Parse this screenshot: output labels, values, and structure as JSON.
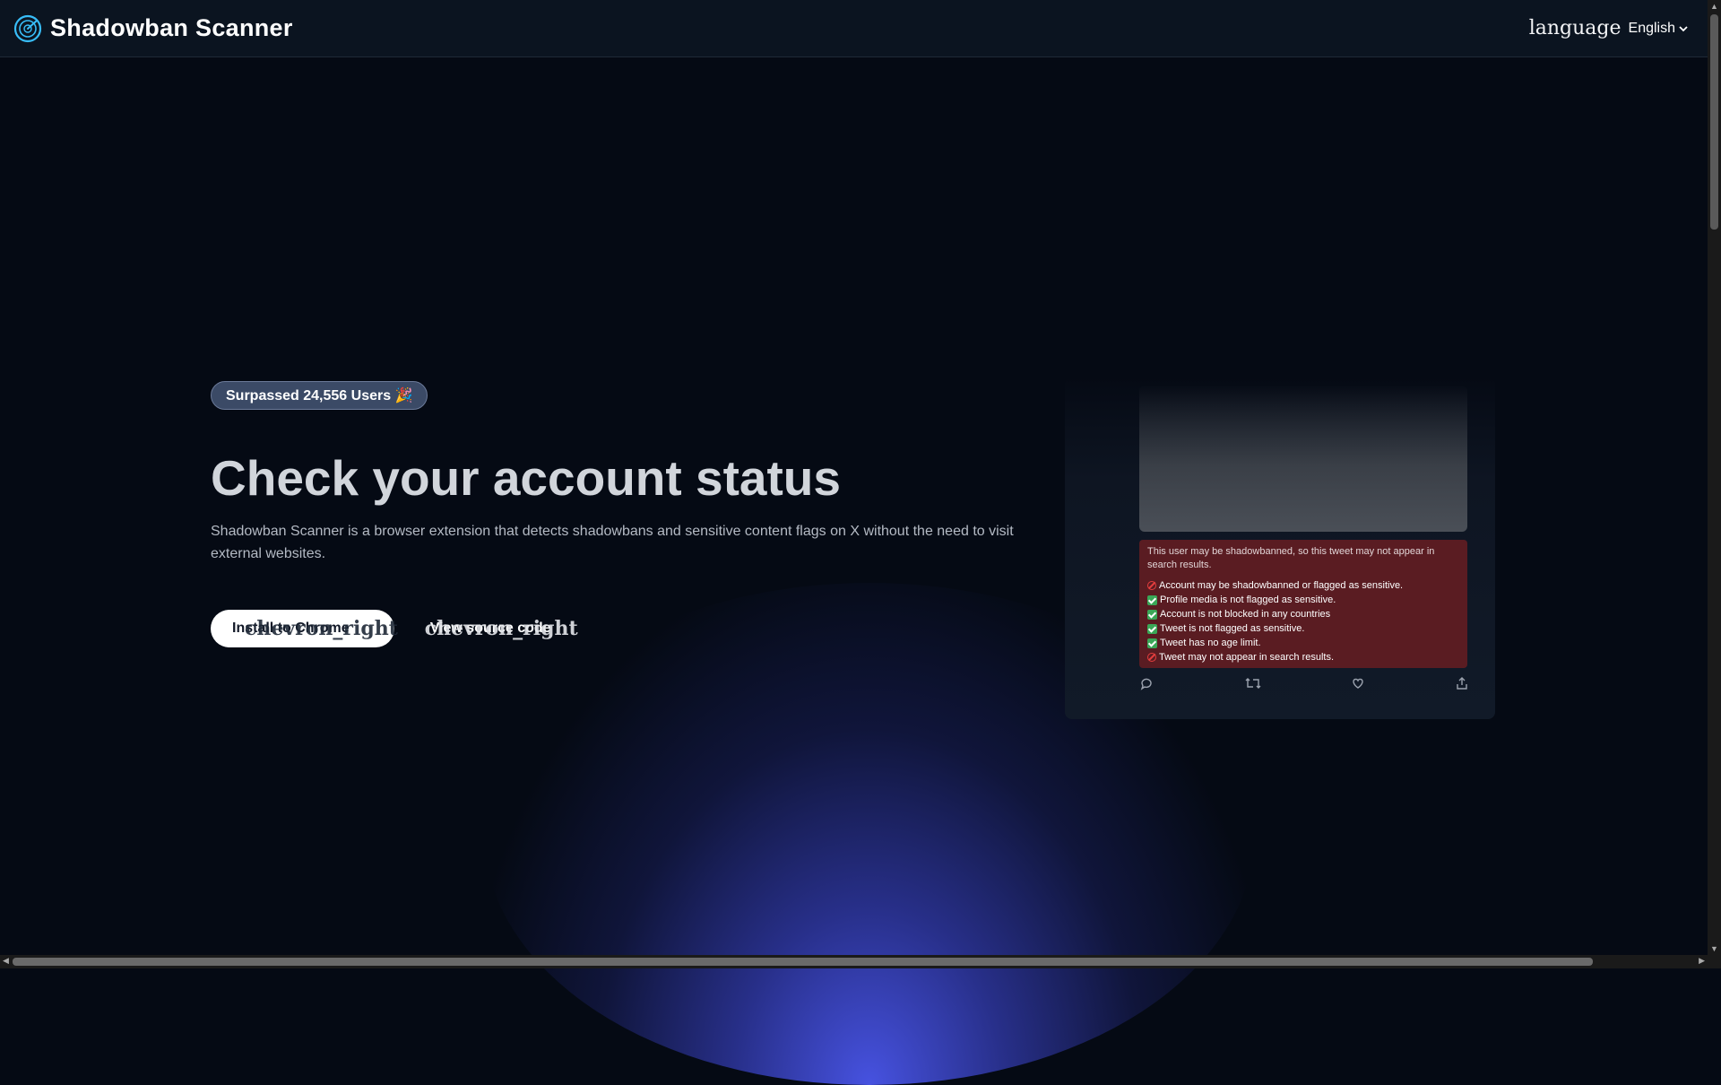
{
  "header": {
    "brand_name": "Shadowban Scanner",
    "language_icon_label": "language",
    "language_selected": "English"
  },
  "hero": {
    "badge": "Surpassed 24,556 Users 🎉",
    "title": "Check your account status",
    "description": "Shadowban Scanner is a browser extension that detects shadowbans and sensitive content flags on X without the need to visit external websites.",
    "primary_button": {
      "label": "Install to Chrome",
      "icon_label": "chevron_right"
    },
    "secondary_button": {
      "label": "View source code",
      "icon_label": "chevron_right"
    }
  },
  "preview": {
    "warning_intro": "This user may be shadowbanned, so this tweet may not appear in search results.",
    "checks": [
      {
        "status": "bad",
        "text": "Account may be shadowbanned or flagged as sensitive."
      },
      {
        "status": "ok",
        "text": "Profile media is not flagged as sensitive."
      },
      {
        "status": "ok",
        "text": "Account is not blocked in any countries"
      },
      {
        "status": "ok",
        "text": "Tweet is not flagged as sensitive."
      },
      {
        "status": "ok",
        "text": "Tweet has no age limit."
      },
      {
        "status": "bad",
        "text": "Tweet may not appear in search results."
      }
    ],
    "actions": [
      "reply-icon",
      "retweet-icon",
      "like-icon",
      "share-icon"
    ]
  },
  "colors": {
    "background": "#050a14",
    "header": "#0b1420",
    "badge": "#3b4a66",
    "warning": "#5a1c22",
    "glow": "#4a56eb"
  }
}
